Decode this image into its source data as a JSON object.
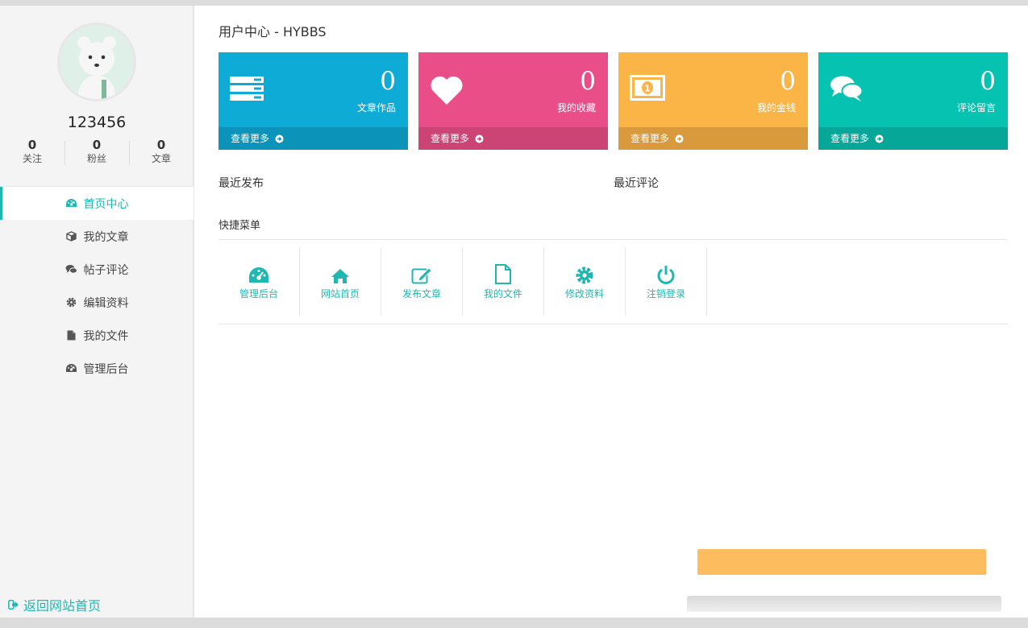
{
  "user": {
    "name": "123456",
    "stats": [
      {
        "value": "0",
        "label": "关注"
      },
      {
        "value": "0",
        "label": "粉丝"
      },
      {
        "value": "0",
        "label": "文章"
      }
    ]
  },
  "sidebar": {
    "items": [
      {
        "label": "首页中心",
        "icon": "dashboard-icon",
        "active": true
      },
      {
        "label": "我的文章",
        "icon": "cube-icon"
      },
      {
        "label": "帖子评论",
        "icon": "comments-icon"
      },
      {
        "label": "编辑资料",
        "icon": "gear-icon"
      },
      {
        "label": "我的文件",
        "icon": "file-icon"
      },
      {
        "label": "管理后台",
        "icon": "dashboard-icon"
      }
    ],
    "back_label": "返回网站首页",
    "back_icon": "sign-out-icon"
  },
  "main": {
    "title": "用户中心 - HYBBS",
    "cards": [
      {
        "value": "0",
        "label": "文章作品",
        "more": "查看更多",
        "icon": "list-icon",
        "color": "#0eabd6",
        "foot_color": "#0c93ba"
      },
      {
        "value": "0",
        "label": "我的收藏",
        "more": "查看更多",
        "icon": "heart-icon",
        "color": "#ea4e88",
        "foot_color": "#cb4474"
      },
      {
        "value": "0",
        "label": "我的金钱",
        "more": "查看更多",
        "icon": "money-icon",
        "color": "#fbb547",
        "foot_color": "#d9993d"
      },
      {
        "value": "0",
        "label": "评论留言",
        "more": "查看更多",
        "icon": "comments-icon",
        "color": "#06c3b1",
        "foot_color": "#06a698"
      }
    ],
    "recent_posts_title": "最近发布",
    "recent_comments_title": "最近评论",
    "quick_title": "快捷菜单",
    "quick_items": [
      {
        "label": "管理后台",
        "icon": "dashboard-icon"
      },
      {
        "label": "网站首页",
        "icon": "home-icon"
      },
      {
        "label": "发布文章",
        "icon": "edit-icon"
      },
      {
        "label": "我的文件",
        "icon": "file-icon"
      },
      {
        "label": "修改资料",
        "icon": "gear-icon"
      },
      {
        "label": "注销登录",
        "icon": "power-icon"
      }
    ]
  },
  "colors": {
    "accent": "#1fb8b1",
    "sidebar_bg": "#f4f4f4"
  }
}
